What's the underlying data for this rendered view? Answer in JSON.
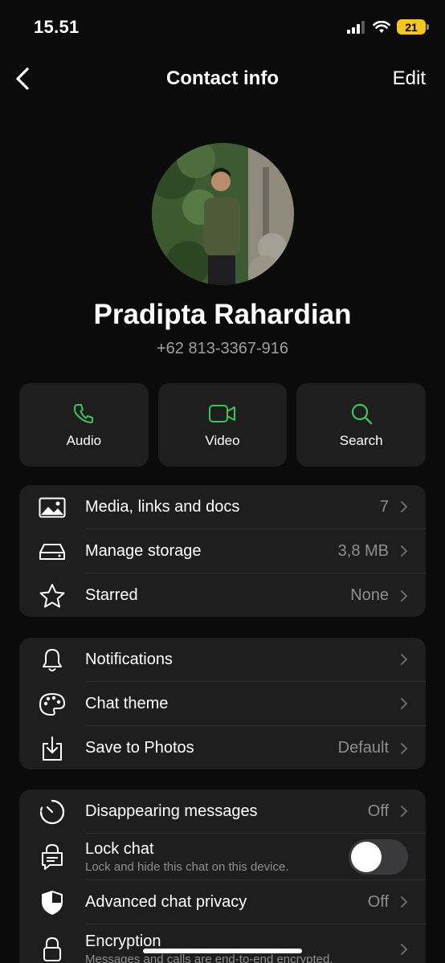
{
  "status_bar": {
    "time": "15.51",
    "battery": "21"
  },
  "nav": {
    "title": "Contact info",
    "edit_label": "Edit"
  },
  "contact": {
    "name": "Pradipta Rahardian",
    "phone": "+62 813-3367-916"
  },
  "actions": [
    {
      "label": "Audio",
      "icon": "phone-icon"
    },
    {
      "label": "Video",
      "icon": "video-icon"
    },
    {
      "label": "Search",
      "icon": "search-icon"
    }
  ],
  "media_section": {
    "media": {
      "label": "Media, links and docs",
      "value": "7"
    },
    "storage": {
      "label": "Manage storage",
      "value": "3,8 MB"
    },
    "starred": {
      "label": "Starred",
      "value": "None"
    }
  },
  "settings_section": {
    "notifications": {
      "label": "Notifications"
    },
    "theme": {
      "label": "Chat theme"
    },
    "save_photos": {
      "label": "Save to Photos",
      "value": "Default"
    }
  },
  "privacy_section": {
    "disappearing": {
      "label": "Disappearing messages",
      "value": "Off"
    },
    "lock": {
      "label": "Lock chat",
      "sub": "Lock and hide this chat on this device.",
      "enabled": false
    },
    "advanced": {
      "label": "Advanced chat privacy",
      "value": "Off"
    },
    "encryption": {
      "label": "Encryption",
      "sub": "Messages and calls are end-to-end encrypted."
    }
  },
  "colors": {
    "accent": "#3fc25a",
    "background": "#0b0b0b",
    "card": "#1e1e1e",
    "secondary_text": "#8e8e8e"
  }
}
